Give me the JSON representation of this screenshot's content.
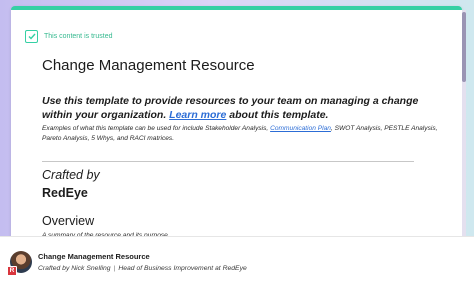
{
  "document": {
    "trust_label": "This content is trusted",
    "title": "Change Management Resource",
    "intro": {
      "text_before": "Use this template to provide resources to your team on managing a change within your organization.",
      "link": "Learn more",
      "text_after": "about this template."
    },
    "examples": {
      "text_before": "Examples of what this template can be used for include Stakeholder Analysis,",
      "link": "Communication Plan",
      "text_after": ", SWOT Analysis, PESTLE Analysis, Pareto Analysis, 5 Whys, and RACI matrices."
    },
    "crafted_label": "Crafted by",
    "crafted_brand": "RedEye",
    "section_heading": "Overview",
    "section_desc": "A summary of the resource and its purpose."
  },
  "footer": {
    "title": "Change Management Resource",
    "author_line": "Crafted by Nick Snelling",
    "separator": "|",
    "author_role": "Head of Business Improvement at RedEye",
    "badge_letter": "R"
  },
  "colors": {
    "accent": "#35d0a4",
    "link": "#2c6dd6",
    "brand_badge": "#d9363e"
  }
}
